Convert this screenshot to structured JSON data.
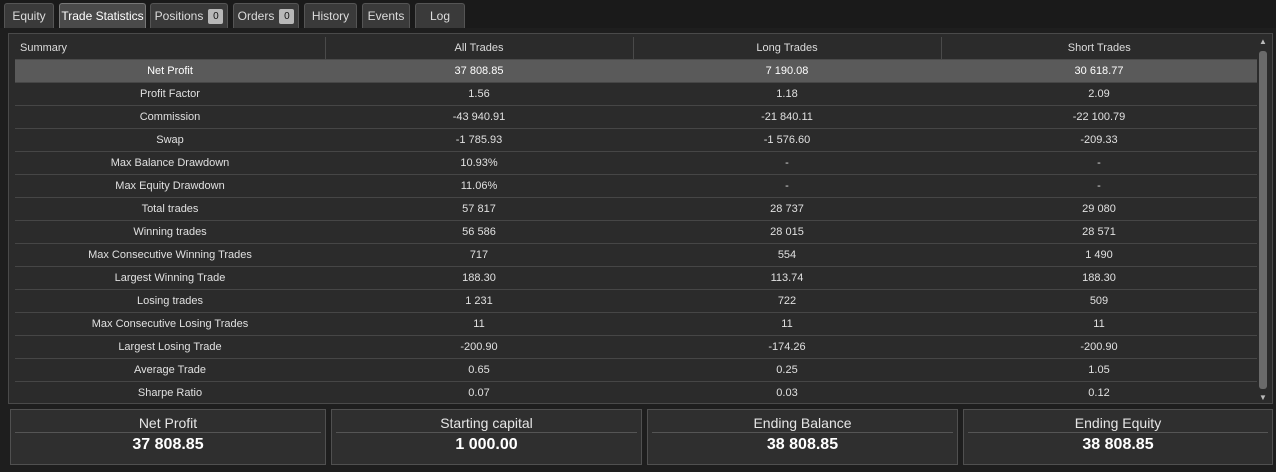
{
  "tabs": [
    {
      "label": "Equity"
    },
    {
      "label": "Trade Statistics"
    },
    {
      "label": "Positions",
      "badge": "0"
    },
    {
      "label": "Orders",
      "badge": "0"
    },
    {
      "label": "History"
    },
    {
      "label": "Events"
    },
    {
      "label": "Log"
    }
  ],
  "active_tab": "Trade Statistics",
  "table": {
    "headers": [
      "Summary",
      "All Trades",
      "Long Trades",
      "Short Trades"
    ],
    "rows": [
      [
        "Net Profit",
        "37 808.85",
        "7 190.08",
        "30 618.77"
      ],
      [
        "Profit Factor",
        "1.56",
        "1.18",
        "2.09"
      ],
      [
        "Commission",
        "-43 940.91",
        "-21 840.11",
        "-22 100.79"
      ],
      [
        "Swap",
        "-1 785.93",
        "-1 576.60",
        "-209.33"
      ],
      [
        "Max Balance Drawdown",
        "10.93%",
        "-",
        "-"
      ],
      [
        "Max Equity Drawdown",
        "11.06%",
        "-",
        "-"
      ],
      [
        "Total trades",
        "57 817",
        "28 737",
        "29 080"
      ],
      [
        "Winning trades",
        "56 586",
        "28 015",
        "28 571"
      ],
      [
        "Max Consecutive Winning Trades",
        "717",
        "554",
        "1 490"
      ],
      [
        "Largest Winning Trade",
        "188.30",
        "113.74",
        "188.30"
      ],
      [
        "Losing trades",
        "1 231",
        "722",
        "509"
      ],
      [
        "Max Consecutive Losing Trades",
        "11",
        "11",
        "11"
      ],
      [
        "Largest Losing Trade",
        "-200.90",
        "-174.26",
        "-200.90"
      ],
      [
        "Average Trade",
        "0.65",
        "0.25",
        "1.05"
      ],
      [
        "Sharpe Ratio",
        "0.07",
        "0.03",
        "0.12"
      ]
    ],
    "selected_row": 0
  },
  "cards": [
    {
      "title": "Net Profit",
      "value": "37 808.85"
    },
    {
      "title": "Starting capital",
      "value": "1 000.00"
    },
    {
      "title": "Ending Balance",
      "value": "38 808.85"
    },
    {
      "title": "Ending Equity",
      "value": "38 808.85"
    }
  ]
}
